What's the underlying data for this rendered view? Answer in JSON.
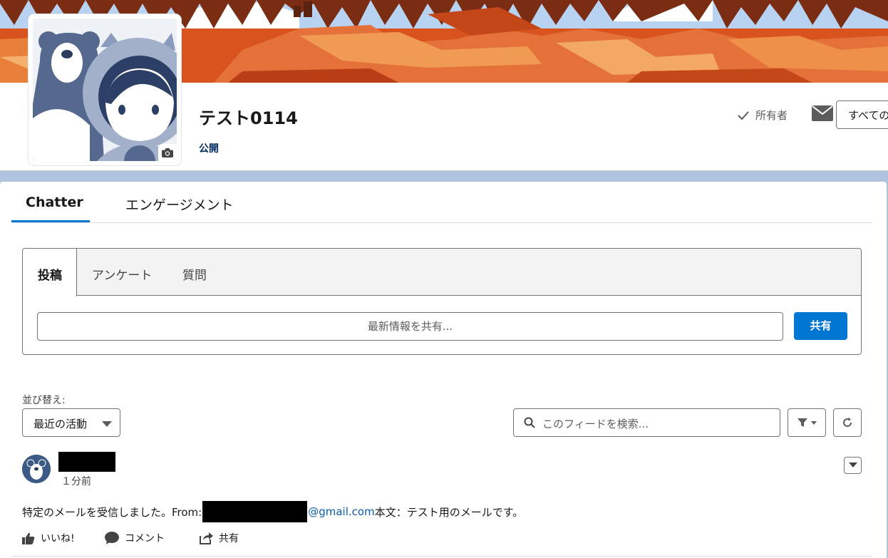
{
  "header": {
    "title": "テスト0114",
    "access": "公開",
    "owner_label": "所有者",
    "all_dropdown": "すべての"
  },
  "tabs": [
    {
      "label": "Chatter",
      "active": true
    },
    {
      "label": "エンゲージメント",
      "active": false
    }
  ],
  "publisher": {
    "tabs": [
      {
        "label": "投稿",
        "active": true
      },
      {
        "label": "アンケート",
        "active": false
      },
      {
        "label": "質問",
        "active": false
      }
    ],
    "placeholder": "最新情報を共有...",
    "share_label": "共有"
  },
  "feed": {
    "sort_label": "並び替え:",
    "sort_value": "最近の活動",
    "search_placeholder": "このフィードを検索...",
    "post": {
      "time": "１分前",
      "body_prefix": "特定のメールを受信しました。From:",
      "email_domain": "@gmail.com",
      "body_suffix": "本文：テスト用のメールです。",
      "actions": {
        "like": "いいね!",
        "comment": "コメント",
        "share": "共有"
      }
    }
  },
  "colors": {
    "brand_blue": "#0176d3",
    "link_blue": "#0b5cab",
    "background": "#b0c4df"
  }
}
